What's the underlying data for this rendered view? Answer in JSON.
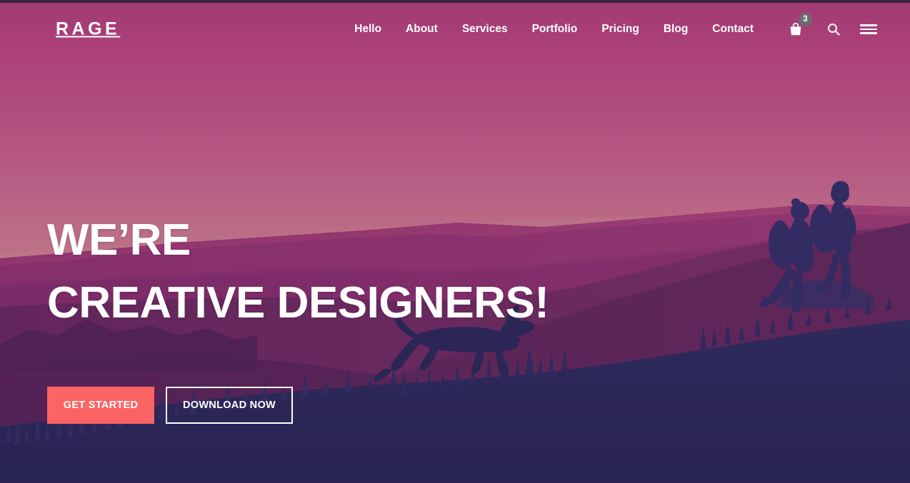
{
  "page": {
    "title": "RAGE — Creative Designers Landing Page"
  },
  "colors": {
    "header_bg": "#ae4179",
    "sky_top": "#a83f74",
    "sky_horizon": "#c08c89",
    "accent_coral": "#fc6363",
    "foreground_navy": "#2a2557",
    "badge_grey": "#6f6a6f",
    "text_white": "#ffffff",
    "top_sliver": "#3a2340"
  },
  "header": {
    "brand": "RAGE",
    "nav_items": [
      {
        "label": "Hello",
        "name": "nav-link-hello"
      },
      {
        "label": "About",
        "name": "nav-link-about"
      },
      {
        "label": "Services",
        "name": "nav-link-services"
      },
      {
        "label": "Portfolio",
        "name": "nav-link-portfolio"
      },
      {
        "label": "Pricing",
        "name": "nav-link-pricing"
      },
      {
        "label": "Blog",
        "name": "nav-link-blog"
      },
      {
        "label": "Contact",
        "name": "nav-link-contact"
      }
    ],
    "tools": {
      "cart": {
        "icon": "shopping-bag-icon",
        "badge_count": "3"
      },
      "search": {
        "icon": "search-icon"
      },
      "menu": {
        "icon": "hamburger-menu-icon"
      }
    }
  },
  "hero": {
    "headline_line_1": "WE’RE",
    "headline_line_2": "CREATIVE DESIGNERS!",
    "buttons": {
      "primary": "GET STARTED",
      "secondary": "DOWNLOAD NOW"
    }
  },
  "illustration": {
    "description": "Sunset mountain landscape silhouette",
    "elements": [
      "gradient-sky",
      "distant-mountain-ridge",
      "mid-mountain-ridge",
      "near-hillside",
      "foreground-hill",
      "running-dog-silhouette",
      "two-hiker-silhouettes",
      "grass-blades"
    ]
  }
}
